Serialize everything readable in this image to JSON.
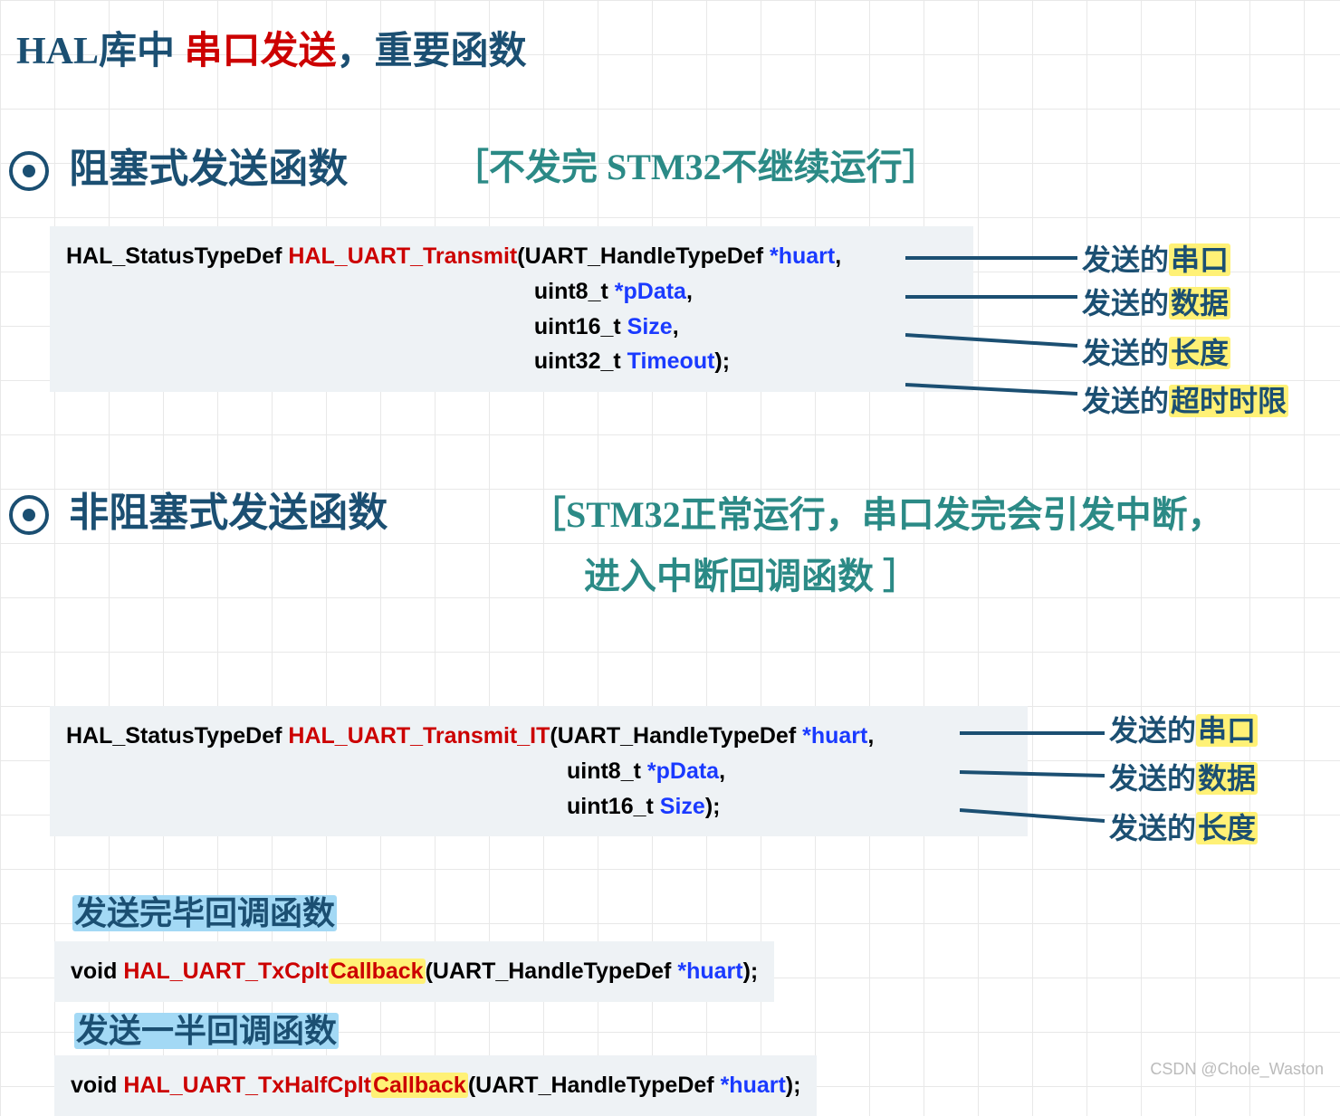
{
  "title": {
    "pre": "HAL库中 ",
    "red": "串口发送",
    "post": "，重要函数"
  },
  "section1": {
    "heading": "阻塞式发送函数",
    "note": "［不发完 STM32不继续运行］",
    "code": {
      "ret": "HAL_StatusTypeDef  ",
      "fn": "HAL_UART_Transmit",
      "p1a": "(UART_HandleTypeDef ",
      "p1b": "*huart",
      "p1c": ",",
      "p2a": "uint8_t ",
      "p2b": "*pData",
      "p2c": ",",
      "p3a": "uint16_t ",
      "p3b": "Size",
      "p3c": ",",
      "p4a": "uint32_t ",
      "p4b": "Timeout",
      "p4c": ");"
    },
    "ann": [
      {
        "pre": "发送的",
        "hl": "串口"
      },
      {
        "pre": "发送的",
        "hl": "数据"
      },
      {
        "pre": "发送的",
        "hl": "长度"
      },
      {
        "pre": "发送的",
        "hl": "超时时限"
      }
    ]
  },
  "section2": {
    "heading": "非阻塞式发送函数",
    "note_l1": "［STM32正常运行，串口发完会引发中断，",
    "note_l2": "进入中断回调函数 ］",
    "code": {
      "ret": "HAL_StatusTypeDef  ",
      "fn": "HAL_UART_Transmit_IT",
      "p1a": "(UART_HandleTypeDef ",
      "p1b": "*huart",
      "p1c": ",",
      "p2a": "uint8_t ",
      "p2b": "*pData",
      "p2c": ",",
      "p3a": "uint16_t ",
      "p3b": "Size",
      "p3c": ");"
    },
    "ann": [
      {
        "pre": "发送的",
        "hl": "串口"
      },
      {
        "pre": "发送的",
        "hl": "数据"
      },
      {
        "pre": "发送的",
        "hl": "长度"
      }
    ]
  },
  "callback1": {
    "label": "发送完毕回调函数",
    "ret": "void ",
    "fn_a": "HAL_UART_TxCplt",
    "fn_b": "Callback",
    "p1a": "(UART_HandleTypeDef  ",
    "p1b": "*huart",
    "p1c": ");"
  },
  "callback2": {
    "label": "发送一半回调函数",
    "ret": "void ",
    "fn_a": "HAL_UART_TxHalfCplt",
    "fn_b": "Callback",
    "p1a": "(UART_HandleTypeDef  ",
    "p1b": "*huart",
    "p1c": ");"
  },
  "watermark": "CSDN @Chole_Waston"
}
